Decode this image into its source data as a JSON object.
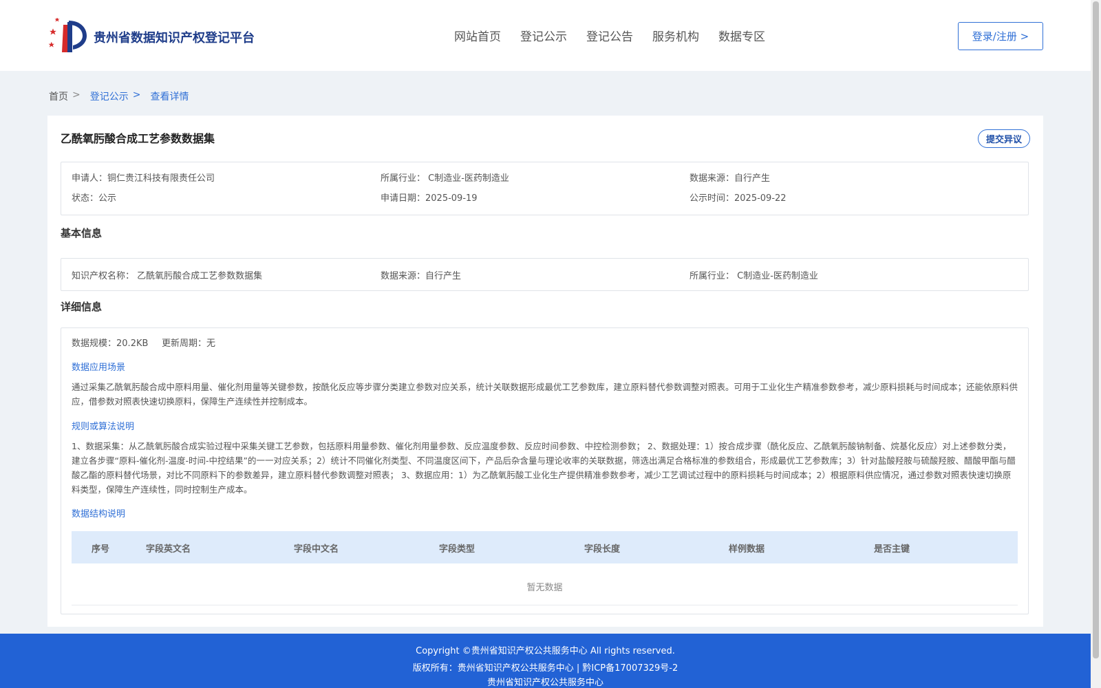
{
  "header": {
    "site_title": "贵州省数据知识产权登记平台",
    "nav": [
      "网站首页",
      "登记公示",
      "登记公告",
      "服务机构",
      "数据专区"
    ],
    "login_label": "登录/注册 >"
  },
  "breadcrumb": {
    "home": "首页",
    "sep": ">",
    "level1": "登记公示",
    "current": "查看详情"
  },
  "dataset": {
    "title": "乙酰氧肟酸合成工艺参数数据集",
    "objection_label": "提交异议"
  },
  "meta": {
    "applicant_label": "申请人：",
    "applicant": "铜仁贵江科技有限责任公司",
    "industry_label": "所属行业：",
    "industry": "C制造业-医药制造业",
    "source_label": "数据来源：",
    "source": "自行产生",
    "status_label": "状态：",
    "status": "公示",
    "apply_date_label": "申请日期：",
    "apply_date": "2025-09-19",
    "public_date_label": "公示时间：",
    "public_date": "2025-09-22"
  },
  "basic": {
    "section_title": "基本信息",
    "ip_name_label": "知识产权名称：",
    "ip_name": "乙酰氧肟酸合成工艺参数数据集",
    "source_label": "数据来源：",
    "source": "自行产生",
    "industry_label": "所属行业：",
    "industry": "C制造业-医药制造业"
  },
  "detail": {
    "section_title": "详细信息",
    "scale_label": "数据规模：",
    "scale": "20.2KB",
    "cycle_label": "更新周期：",
    "cycle": "无",
    "scenario_title": "数据应用场景",
    "scenario_text": "通过采集乙酰氧肟酸合成中原料用量、催化剂用量等关键参数，按酰化反应等步骤分类建立参数对应关系，统计关联数据形成最优工艺参数库，建立原料替代参数调整对照表。可用于工业化生产精准参数参考，减少原料损耗与时间成本；还能依原料供应，借参数对照表快速切换原料，保障生产连续性并控制成本。",
    "rules_title": "规则或算法说明",
    "rules_text": "1、数据采集：从乙酰氧肟酸合成实验过程中采集关键工艺参数，包括原料用量参数、催化剂用量参数、反应温度参数、反应时间参数、中控检测参数； 2、数据处理：1）按合成步骤（酰化反应、乙酰氧肟酸钠制备、烷基化反应）对上述参数分类，建立各步骤“原料-催化剂-温度-时间-中控结果”的一一对应关系；2）统计不同催化剂类型、不同温度区间下，产品后杂含量与理论收率的关联数据，筛选出满足合格标准的参数组合，形成最优工艺参数库；3）针对盐酸羟胺与硫酸羟胺、醋酸甲酯与醋酸乙酯的原料替代场景，对比不同原料下的参数差异，建立原料替代参数调整对照表； 3、数据应用：1）为乙酰氧肟酸工业化生产提供精准参数参考，减少工艺调试过程中的原料损耗与时间成本；2）根据原料供应情况，通过参数对照表快速切换原料类型，保障生产连续性，同时控制生产成本。",
    "structure_title": "数据结构说明",
    "table_headers": [
      "序号",
      "字段英文名",
      "字段中文名",
      "字段类型",
      "字段长度",
      "样例数据",
      "是否主键"
    ],
    "empty_text": "暂无数据"
  },
  "footer": {
    "line1": "Copyright ©贵州省知识产权公共服务中心 All rights reserved.",
    "line2": "版权所有：贵州省知识产权公共服务中心 | 黔ICP备17007329号-2",
    "line3": "贵州省知识产权公共服务中心"
  },
  "colors": {
    "accent": "#2f6fd6",
    "footer_bg": "#2262d5",
    "page_bg": "#eef2f6",
    "table_head_bg": "#deebfb"
  }
}
